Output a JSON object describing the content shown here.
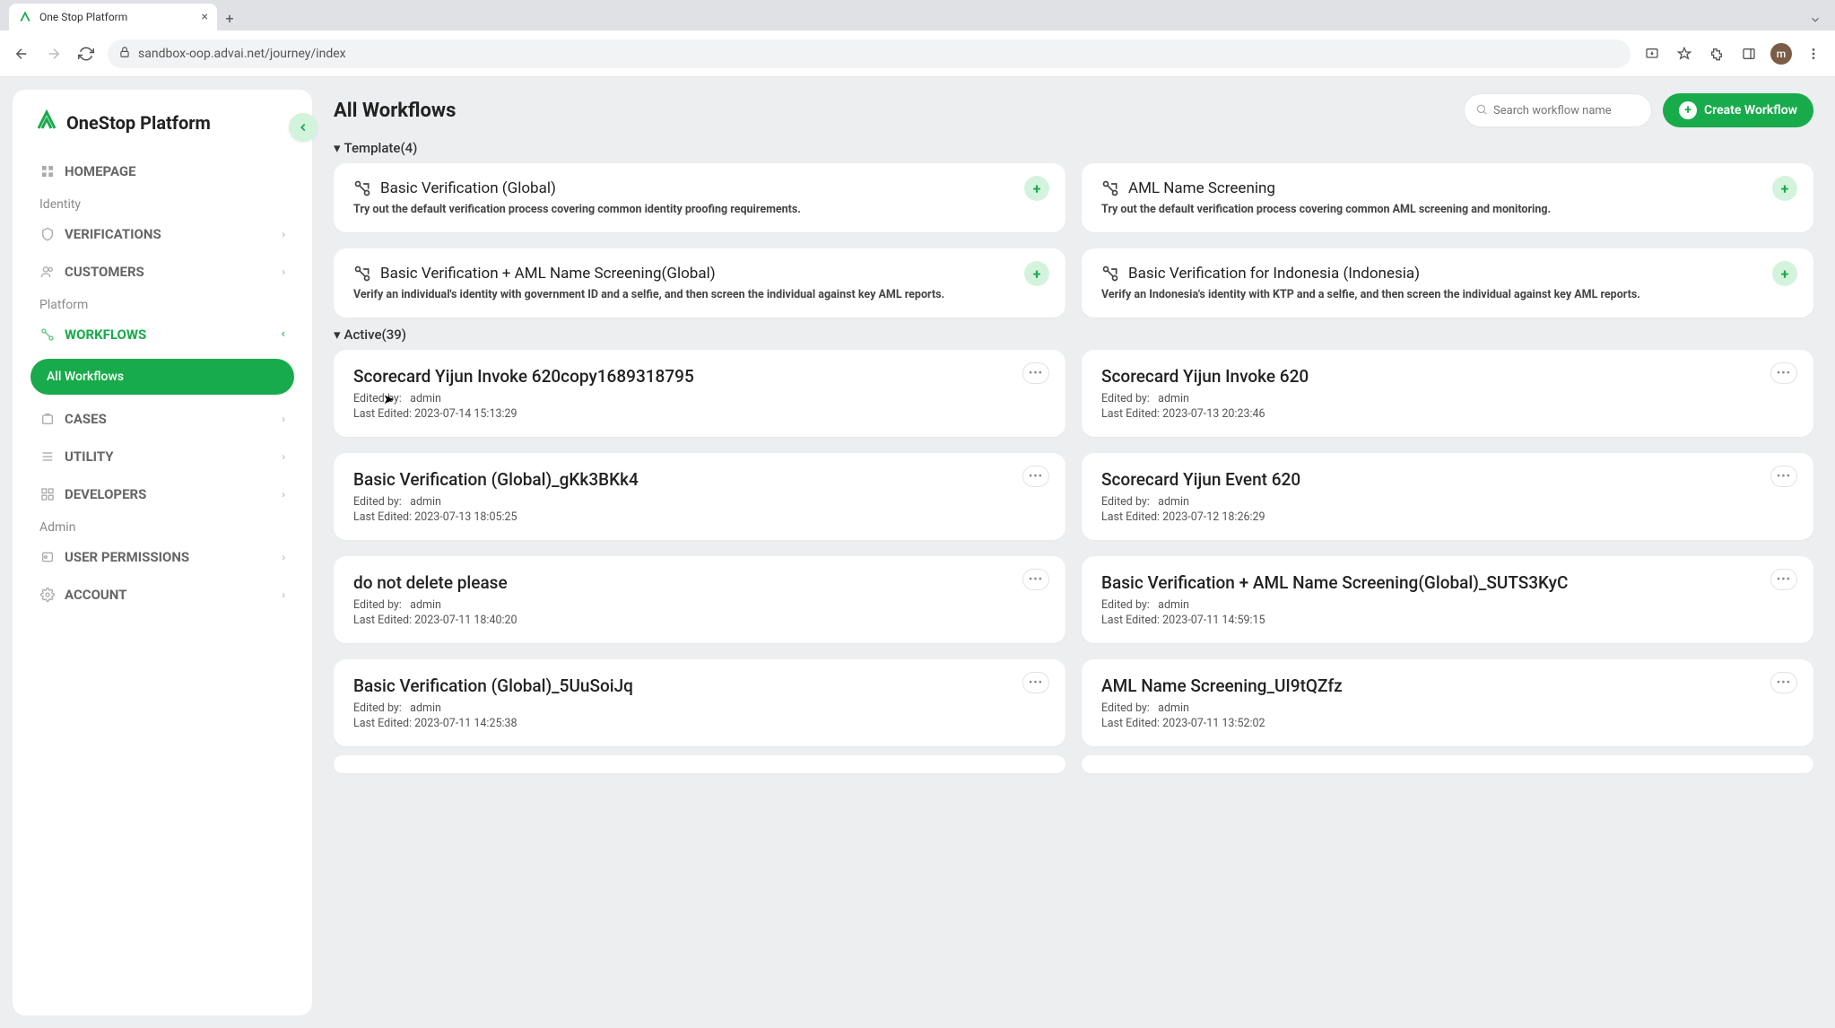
{
  "browser": {
    "tab_title": "One Stop Platform",
    "url": "sandbox-oop.advai.net/journey/index",
    "avatar_letter": "m"
  },
  "brand": {
    "name": "OneStop Platform"
  },
  "sidebar": {
    "items": [
      {
        "label": "HOMEPAGE"
      }
    ],
    "sections": [
      {
        "label": "Identity",
        "items": [
          {
            "label": "VERIFICATIONS"
          },
          {
            "label": "CUSTOMERS"
          }
        ]
      },
      {
        "label": "Platform",
        "items": [
          {
            "label": "WORKFLOWS",
            "active": true,
            "sub": "All Workflows"
          },
          {
            "label": "CASES"
          },
          {
            "label": "UTILITY"
          },
          {
            "label": "DEVELOPERS"
          }
        ]
      },
      {
        "label": "Admin",
        "items": [
          {
            "label": "USER PERMISSIONS"
          },
          {
            "label": "ACCOUNT"
          }
        ]
      }
    ]
  },
  "page": {
    "title": "All Workflows",
    "search_placeholder": "Search workflow name",
    "create_button": "Create Workflow"
  },
  "templates": {
    "header": "Template(4)",
    "items": [
      {
        "title": "Basic Verification (Global)",
        "desc": "Try out the default verification process covering common identity proofing requirements."
      },
      {
        "title": "AML Name Screening",
        "desc": "Try out the default verification process covering common AML screening and monitoring."
      },
      {
        "title": "Basic Verification + AML Name Screening(Global)",
        "desc": "Verify an individual's identity with government ID and a selfie, and then screen the individual against key AML reports."
      },
      {
        "title": "Basic Verification for Indonesia (Indonesia)",
        "desc": "Verify an Indonesia's identity with KTP and a selfie, and then screen the individual against key AML reports."
      }
    ]
  },
  "active": {
    "header": "Active(39)",
    "edited_by_label": "Edited by:",
    "last_edited_label": "Last Edited:",
    "items": [
      {
        "title": "Scorecard Yijun Invoke 620copy1689318795",
        "editor": "admin",
        "ts": "2023-07-14 15:13:29"
      },
      {
        "title": "Scorecard Yijun Invoke 620",
        "editor": "admin",
        "ts": "2023-07-13 20:23:46"
      },
      {
        "title": "Basic Verification (Global)_gKk3BKk4",
        "editor": "admin",
        "ts": "2023-07-13 18:05:25"
      },
      {
        "title": "Scorecard Yijun Event 620",
        "editor": "admin",
        "ts": "2023-07-12 18:26:29"
      },
      {
        "title": "do not delete please",
        "editor": "admin",
        "ts": "2023-07-11 18:40:20"
      },
      {
        "title": "Basic Verification + AML Name Screening(Global)_SUTS3KyC",
        "editor": "admin",
        "ts": "2023-07-11 14:59:15"
      },
      {
        "title": "Basic Verification (Global)_5UuSoiJq",
        "editor": "admin",
        "ts": "2023-07-11 14:25:38"
      },
      {
        "title": "AML Name Screening_UI9tQZfz",
        "editor": "admin",
        "ts": "2023-07-11 13:52:02"
      }
    ]
  }
}
